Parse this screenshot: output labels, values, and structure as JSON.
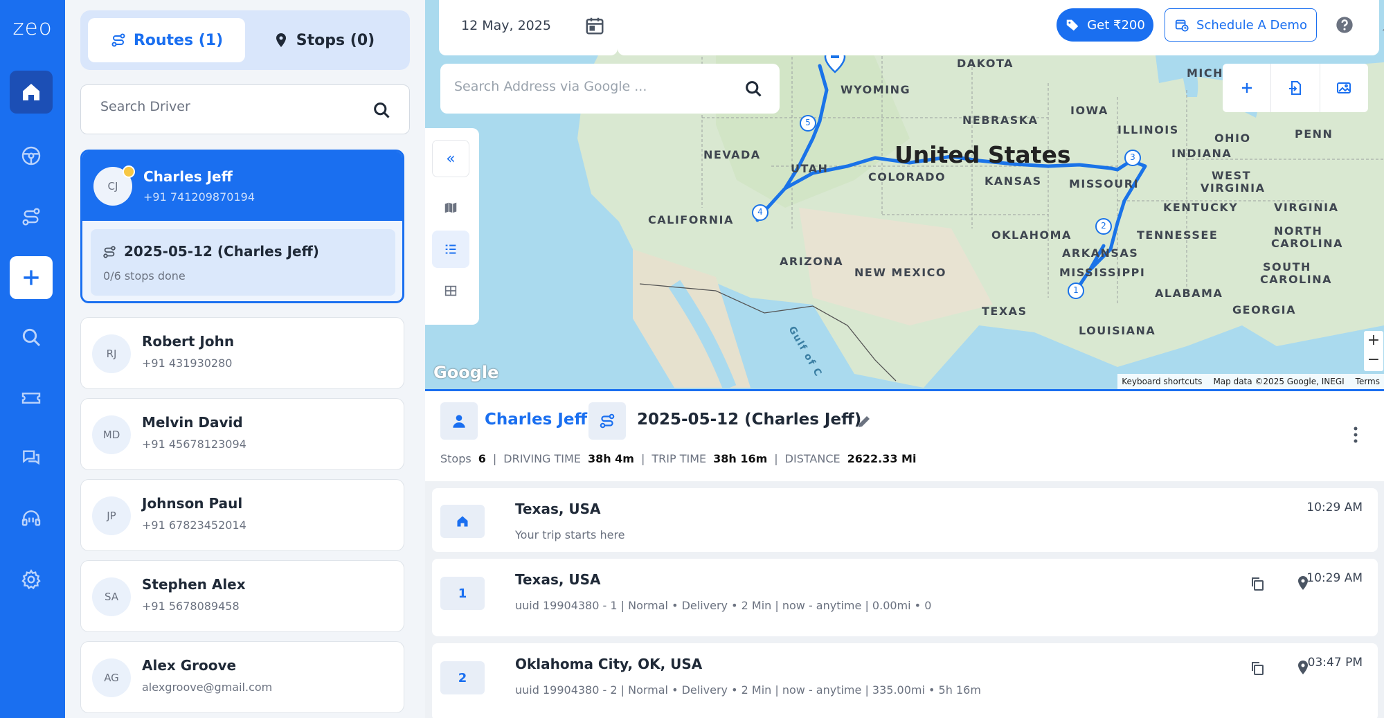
{
  "app": {
    "logo": "zeo"
  },
  "sidebar": {
    "items": [
      {
        "name": "home",
        "icon": "home-icon",
        "active": true
      },
      {
        "name": "drivers",
        "icon": "steering-wheel-icon"
      },
      {
        "name": "routes",
        "icon": "route-icon"
      },
      {
        "name": "add",
        "icon": "plus-icon"
      },
      {
        "name": "search",
        "icon": "search-icon"
      },
      {
        "name": "tickets",
        "icon": "ticket-icon"
      },
      {
        "name": "chat",
        "icon": "chat-icon"
      },
      {
        "name": "support",
        "icon": "headset-icon"
      },
      {
        "name": "settings",
        "icon": "gear-icon"
      }
    ]
  },
  "tabs": {
    "routes": "Routes (1)",
    "stops": "Stops (0)"
  },
  "search_driver": {
    "placeholder": "Search Driver"
  },
  "drivers": [
    {
      "initials": "CJ",
      "name": "Charles Jeff",
      "contact": "+91 741209870194",
      "route": "2025-05-12 (Charles Jeff)",
      "progress": "0/6 stops done"
    },
    {
      "initials": "RJ",
      "name": "Robert John",
      "contact": "+91 431930280"
    },
    {
      "initials": "MD",
      "name": "Melvin David",
      "contact": "+91 45678123094"
    },
    {
      "initials": "JP",
      "name": "Johnson Paul",
      "contact": "+91 67823452014"
    },
    {
      "initials": "SA",
      "name": "Stephen Alex",
      "contact": "+91 5678089458"
    },
    {
      "initials": "AG",
      "name": "Alex Groove",
      "contact": "alexgroove@gmail.com"
    }
  ],
  "topbar": {
    "date": "12 May, 2025",
    "get_label": "Get ₹200",
    "demo_label": "Schedule A Demo"
  },
  "address_search": {
    "placeholder": "Search Address via Google ..."
  },
  "map": {
    "country": "United States",
    "labels": [
      "DAKOTA",
      "WYOMING",
      "NEBRASKA",
      "IOWA",
      "MICH",
      "OHIO",
      "PENN",
      "ILLINOIS",
      "INDIANA",
      "NEVADA",
      "UTAH",
      "COLORADO",
      "KANSAS",
      "MISSOURI",
      "WEST",
      "VIRGINIA",
      "KENTUCKY",
      "VIRGINIA",
      "CALIFORNIA",
      "OKLAHOMA",
      "TENNESSEE",
      "NORTH",
      "CAROLINA",
      "ARIZONA",
      "NEW MEXICO",
      "ARKANSAS",
      "SOUTH",
      "CAROLINA",
      "MISSISSIPPI",
      "ALABAMA",
      "GEORGIA",
      "TEXAS",
      "LOUISIANA",
      "Gulf of C"
    ],
    "markers": [
      "1",
      "2",
      "3",
      "4",
      "5"
    ],
    "google": "Google",
    "attribution": {
      "shortcuts": "Keyboard shortcuts",
      "data": "Map data ©2025 Google, INEGI",
      "terms": "Terms"
    },
    "zoom_in": "+",
    "zoom_out": "−",
    "collapse": "«"
  },
  "route": {
    "driver": "Charles Jeff",
    "name": "2025-05-12 (Charles Jeff)",
    "stats": {
      "stops_label": "Stops",
      "stops": "6",
      "driving_label": "DRIVING TIME",
      "driving": "38h 4m",
      "trip_label": "TRIP TIME",
      "trip": "38h 16m",
      "distance_label": "DISTANCE",
      "distance": "2622.33 Mi"
    },
    "stops": [
      {
        "num": "",
        "name": "Texas, USA",
        "sub": "Your trip starts here",
        "time": "10:29 AM"
      },
      {
        "num": "1",
        "name": "Texas, USA",
        "sub": "uuid 19904380 - 1  |  Normal • Delivery • 2 Min |  now - anytime  |  0.00mi • 0",
        "time": "10:29 AM"
      },
      {
        "num": "2",
        "name": "Oklahoma City, OK, USA",
        "sub": "uuid 19904380 - 2  |  Normal • Delivery • 2 Min |  now - anytime  |  335.00mi • 5h 16m",
        "time": "03:47 PM"
      }
    ]
  }
}
